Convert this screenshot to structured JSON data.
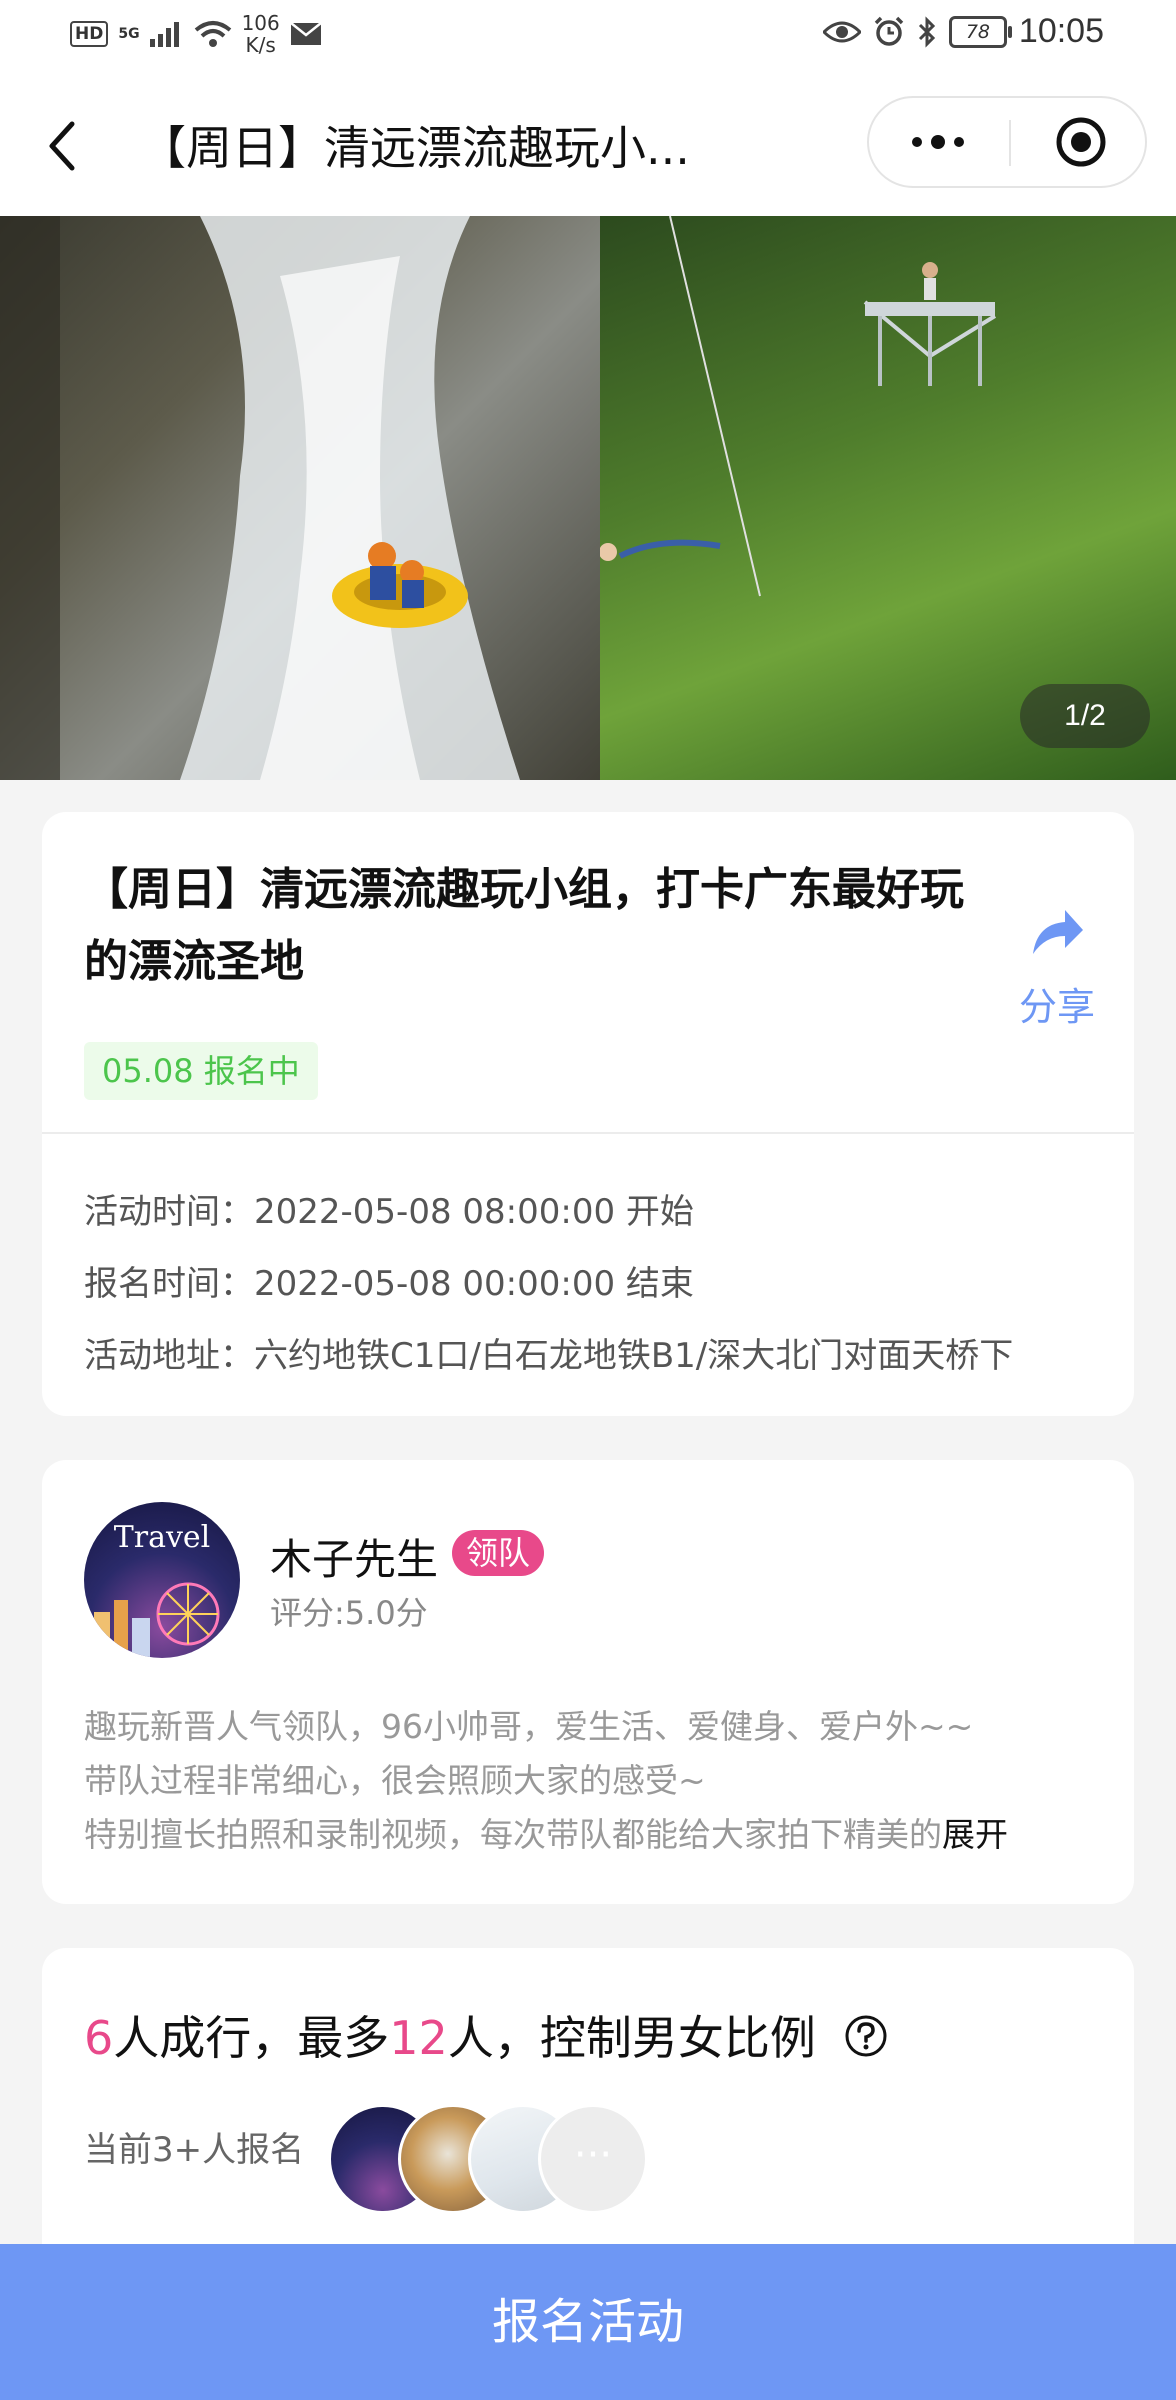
{
  "status_bar": {
    "hd": "HD",
    "network": "5G",
    "speed_value": "106",
    "speed_unit": "K/s",
    "battery": "78",
    "time": "10:05"
  },
  "nav": {
    "title": "【周日】清远漂流趣玩小..."
  },
  "banner": {
    "counter": "1/2"
  },
  "event": {
    "title": "【周日】清远漂流趣玩小组，打卡广东最好玩的漂流圣地",
    "share_label": "分享",
    "status_badge": "05.08 报名中",
    "info": [
      "活动时间：2022-05-08 08:00:00 开始",
      "报名时间：2022-05-08 00:00:00 结束",
      "活动地址：六约地铁C1口/白石龙地铁B1/深大北门对面天桥下"
    ]
  },
  "leader": {
    "avatar_text": "Travel",
    "name": "木子先生",
    "badge": "领队",
    "rating": "评分:5.0分",
    "desc_lines": [
      "趣玩新晋人气领队，96小帅哥，爱生活、爱健身、爱户外~~",
      "带队过程非常细心，很会照顾大家的感受~",
      "特别擅长拍照和录制视频，每次带队都能给大家拍下精美的"
    ],
    "expand_label": "展开"
  },
  "group": {
    "min_count": "6",
    "text1": "人成行，最多",
    "max_count": "12",
    "text2": "人，控制男女比例",
    "signup_label": "当前3+人报名",
    "more_label": "···"
  },
  "bottom": {
    "signup_button": "报名活动"
  },
  "colors": {
    "accent": "#6e97f4",
    "pink": "#e8498a",
    "green": "#4cc54c"
  }
}
